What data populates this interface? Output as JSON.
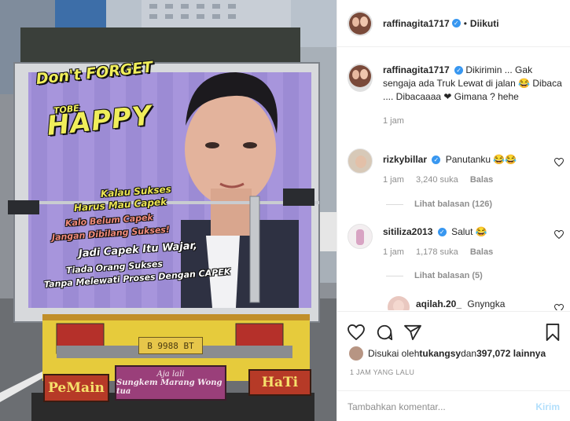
{
  "post": {
    "photo": {
      "banner": {
        "line1": "Don't FORGET",
        "line2": "TOBE",
        "line3": "HAPPY",
        "slogans": [
          "Kalau Sukses",
          "Harus Mau Capek",
          "Kalo Belum Capek",
          "Jangan Dibilang Sukses!",
          "Jadi Capek Itu Wajar,",
          "Tiada Orang Sukses",
          "Tanpa Melewati Proses Dengan CAPEK"
        ]
      },
      "plate": "B 9988 BT",
      "bumper_left": "PeMain",
      "bumper_mid_top": "Aja lali",
      "bumper_mid_bottom": "Sungkem Marang Wong tua",
      "bumper_right": "HaTi"
    },
    "header": {
      "username": "raffinagita1717",
      "separator": "•",
      "follow_status": "Diikuti"
    },
    "caption": {
      "username": "raffinagita1717",
      "text": "Dikirimin ... Gak sengaja ada Truk Lewat di jalan 😂 Dibaca .... Dibacaaaa ❤ Gimana ? hehe",
      "time": "1 jam"
    },
    "comments": [
      {
        "username": "rizkybillar",
        "text": "Panutanku 😂😂",
        "time": "1 jam",
        "likes": "3,240 suka",
        "reply": "Balas",
        "view_replies": "Lihat balasan (126)"
      },
      {
        "username": "sitiliza2013",
        "text": "Salut 😂",
        "time": "1 jam",
        "likes": "1,178 suka",
        "reply": "Balas",
        "view_replies": "Lihat balasan (5)"
      },
      {
        "username": "aqilah.20_",
        "text": "Gnyngka"
      }
    ],
    "liked_by": {
      "prefix": "Disukai oleh ",
      "user": "tukangsy",
      "middle": " dan ",
      "count": "397,072 lainnya"
    },
    "timestamp": "1 JAM YANG LALU",
    "add_comment": {
      "placeholder": "Tambahkan komentar...",
      "send_label": "Kirim"
    }
  },
  "colors": {
    "verified": "#3897f0",
    "muted": "#8e8e8e",
    "send_disabled": "#b2dffc",
    "banner_purple": "#9c8ad6"
  },
  "icons": [
    "verified-icon",
    "heart-icon",
    "comment-icon",
    "share-icon",
    "bookmark-icon"
  ]
}
